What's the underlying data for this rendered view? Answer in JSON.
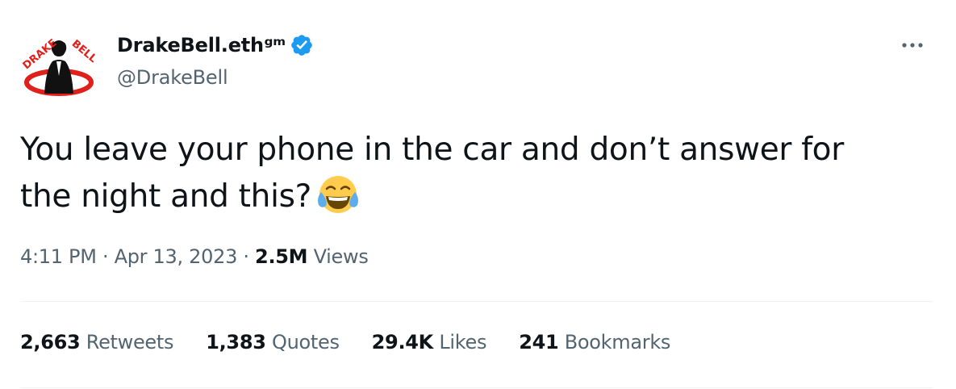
{
  "author": {
    "display_name": "DrakeBell.eth",
    "name_suffix": "ᵍᵐ",
    "handle": "@DrakeBell",
    "verified": true,
    "avatar_icon": "drake-bell-logo-avatar",
    "avatar_logo_text": "DRAKE BELL"
  },
  "tweet": {
    "text_line1": "You leave your phone in the car and don’t answer for",
    "text_line2": "the night and this?",
    "emoji": "face-with-tears-of-joy"
  },
  "meta": {
    "time": "4:11 PM",
    "separator": " · ",
    "date": "Apr 13, 2023",
    "views_count": "2.5M",
    "views_label": "Views"
  },
  "stats": {
    "retweets_count": "2,663",
    "retweets_label": "Retweets",
    "quotes_count": "1,383",
    "quotes_label": "Quotes",
    "likes_count": "29.4K",
    "likes_label": "Likes",
    "bookmarks_count": "241",
    "bookmarks_label": "Bookmarks"
  },
  "colors": {
    "text_primary": "#0f1419",
    "text_secondary": "#536471",
    "verified_blue": "#1d9bf0",
    "divider": "#eff3f4",
    "logo_red": "#e0201b"
  }
}
